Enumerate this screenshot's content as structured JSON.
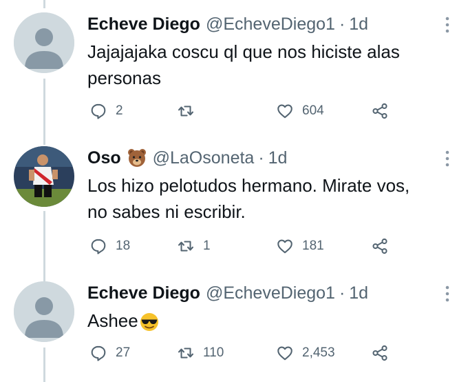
{
  "tweets": [
    {
      "name": "Echeve Diego",
      "handle": "@EcheveDiego1",
      "separator": "·",
      "time": "1d",
      "text_line1": "Jajajajaka coscu ql que nos hiciste alas",
      "text_line2": "personas",
      "replies": "2",
      "retweets": "",
      "likes": "604",
      "avatar": "default-person-avatar"
    },
    {
      "name": "Oso",
      "name_emoji": "bear-face",
      "handle": "@LaOsoneta",
      "separator": "·",
      "time": "1d",
      "text_line1": "Los hizo pelotudos hermano. Mirate vos,",
      "text_line2": "no sabes ni escribir.",
      "replies": "18",
      "retweets": "1",
      "likes": "181",
      "avatar": "football-player-photo"
    },
    {
      "name": "Echeve Diego",
      "handle": "@EcheveDiego1",
      "separator": "·",
      "time": "1d",
      "text_line1": "Ashee",
      "text_emoji": "smiling-face-with-sunglasses",
      "replies": "27",
      "retweets": "110",
      "likes": "2,453",
      "avatar": "default-person-avatar"
    }
  ],
  "colors": {
    "text_primary": "#0f1419",
    "text_secondary": "#536471",
    "thread_line": "#cfd9de",
    "avatar_bg": "#cfd9de",
    "avatar_figure": "#8899a6"
  },
  "icons": [
    "reply-icon",
    "retweet-icon",
    "like-icon",
    "share-icon",
    "more-options-icon"
  ]
}
